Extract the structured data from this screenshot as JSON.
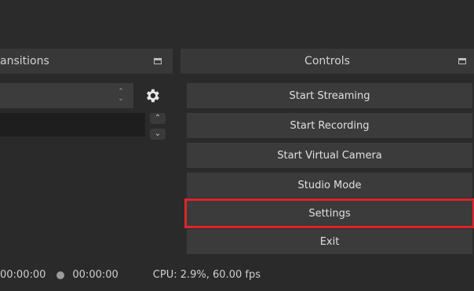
{
  "transitions_dock": {
    "title": "ansitions"
  },
  "controls_dock": {
    "title": "Controls",
    "buttons": [
      {
        "label": "Start Streaming"
      },
      {
        "label": "Start Recording"
      },
      {
        "label": "Start Virtual Camera"
      },
      {
        "label": "Studio Mode"
      },
      {
        "label": "Settings"
      },
      {
        "label": "Exit"
      }
    ]
  },
  "status": {
    "rec_time": "00:00:00",
    "stream_time": "00:00:00",
    "cpu": "CPU: 2.9%, 60.00 fps"
  },
  "colors": {
    "highlight": "#e0242a",
    "panel": "#383838",
    "background": "#2a2a2a"
  }
}
